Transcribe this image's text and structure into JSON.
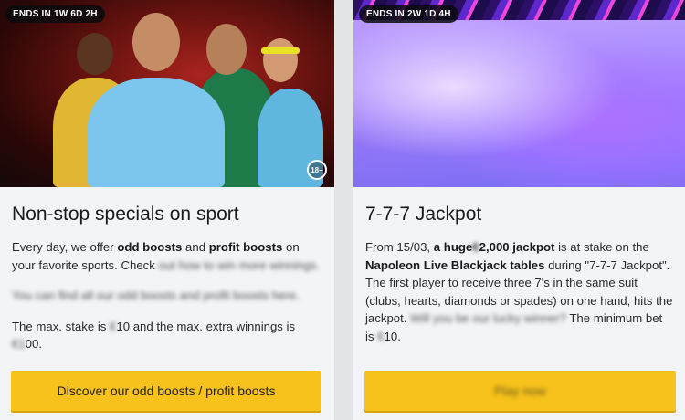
{
  "cards": [
    {
      "badge": "ENDS IN 1W 6D 2H",
      "age_label": "18+",
      "title": "Non-stop specials on sport",
      "p1_a": "Every day, we offer ",
      "p1_b": "odd boosts",
      "p1_c": " and ",
      "p1_d": "profit boosts",
      "p1_e": " on your favorite sports. Check ",
      "p1_blur": "out how to win more winnings.",
      "p2_blur": "You can find all our odd boosts and profit boosts here.",
      "p3_a": "The max. stake is ",
      "p3_blur1": "€",
      "p3_b": "10 and the max. extra winnings is ",
      "p3_blur2": "€1",
      "p3_c": "00.",
      "cta": "Discover our odd boosts / profit boosts"
    },
    {
      "badge": "ENDS IN 2W 1D 4H",
      "title": "7-7-7 Jackpot",
      "t1": "From 15/03, ",
      "t2": "a huge",
      "t2_blur": "€",
      "t3": "2,000 jackpot",
      "t4": " is at stake on the ",
      "t5": "Napoleon Live Blackjack tables",
      "t6": " during \"7-7-7 Jackpot\". The first player to receive three 7's in the same suit (clubs, hearts, diamonds or spades) on one hand, hits the jackpot. ",
      "t6_blur": "Will you be our lucky winner?",
      "t7": " The minimum bet is ",
      "t7_blur": "€",
      "t8": "10.",
      "cta": "Play now"
    }
  ]
}
